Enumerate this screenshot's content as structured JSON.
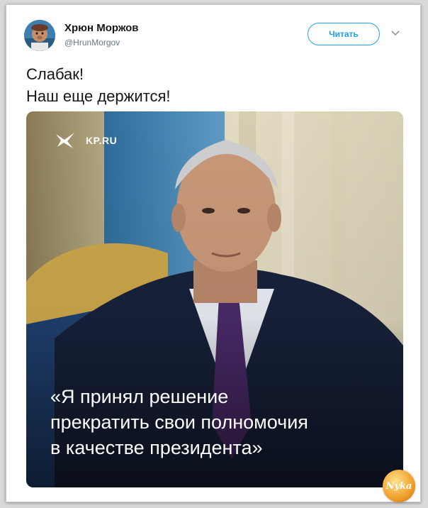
{
  "author": {
    "name": "Хрюн Моржов",
    "handle": "@HrunMorgov"
  },
  "follow_button": {
    "label": "Читать"
  },
  "menu": {
    "icon": "chevron-down-icon"
  },
  "tweet": {
    "lines": [
      "Слабак!",
      "Наш еще держится!"
    ]
  },
  "media": {
    "brand": "KP.RU",
    "quote_lines": [
      "«Я принял решение",
      "прекратить свои полномочия",
      "в качестве президента»"
    ]
  },
  "watermark": {
    "text": "Nyka"
  },
  "colors": {
    "accent": "#1da1f2",
    "text": "#14171a",
    "muted": "#657786"
  }
}
